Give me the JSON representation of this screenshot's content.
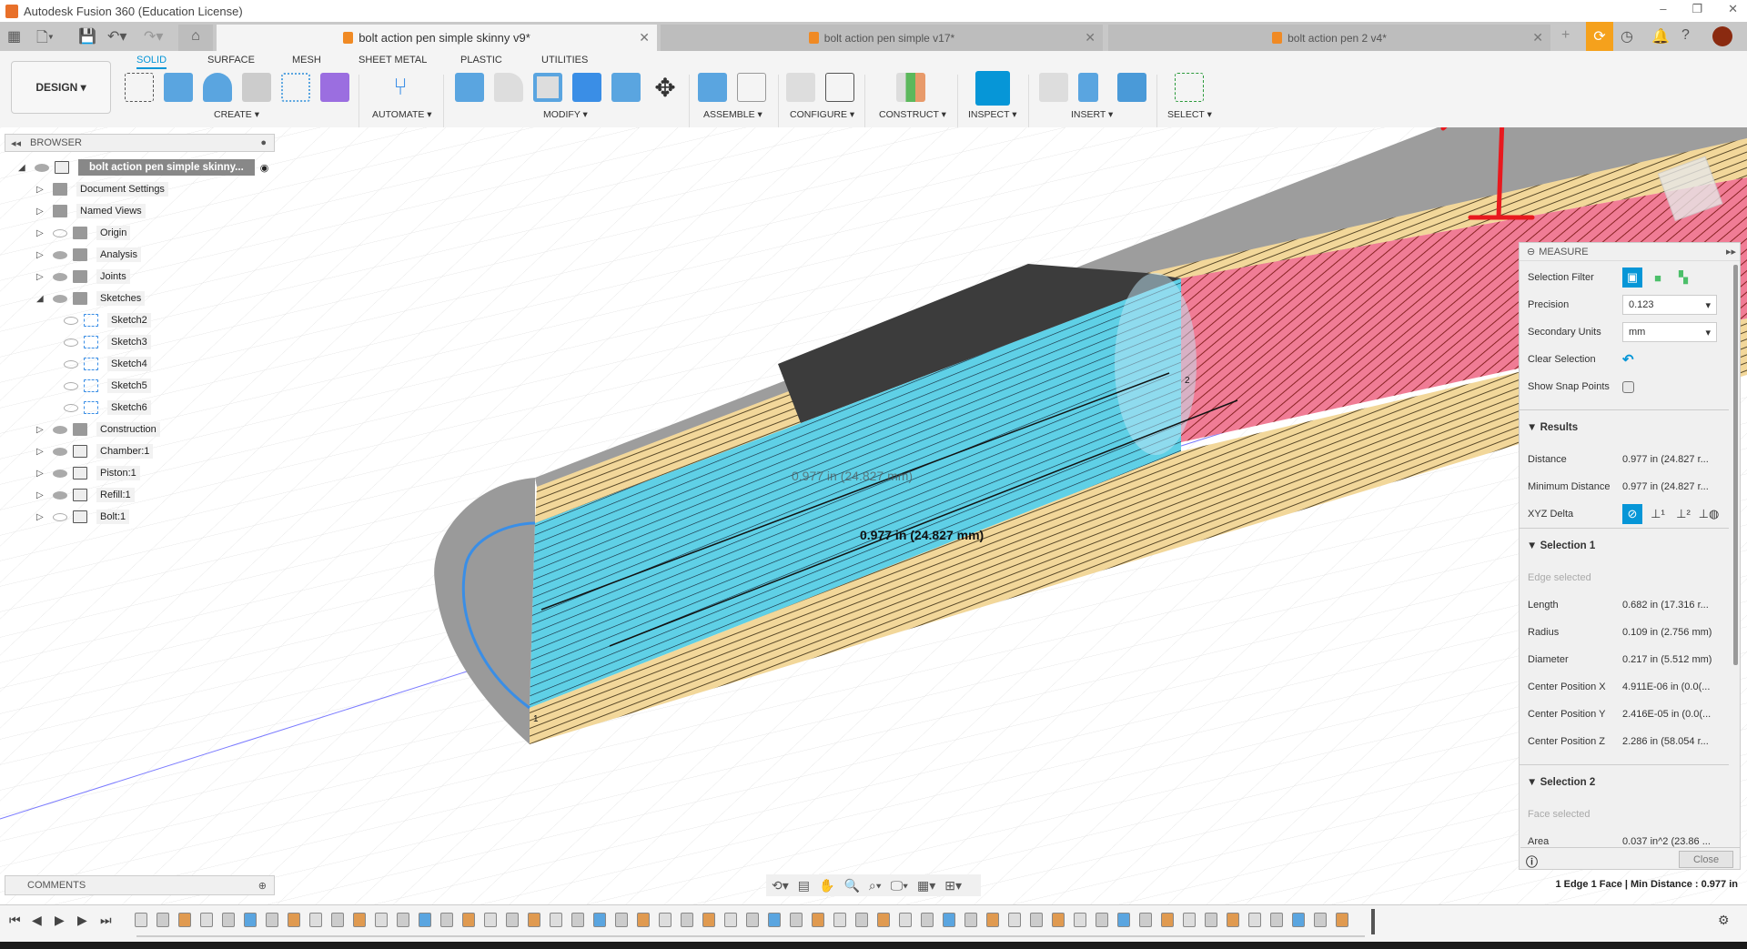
{
  "app": {
    "title": "Autodesk Fusion 360 (Education License)",
    "window_controls": [
      "–",
      "❐",
      "✕"
    ]
  },
  "tabs": [
    {
      "label": "bolt action pen simple skinny v9*",
      "active": true
    },
    {
      "label": "bolt action pen simple v17*",
      "active": false
    },
    {
      "label": "bolt action pen 2 v4*",
      "active": false
    }
  ],
  "toolbar": {
    "workspace": "DESIGN ▾",
    "tabs": [
      "SOLID",
      "SURFACE",
      "MESH",
      "SHEET METAL",
      "PLASTIC",
      "UTILITIES"
    ],
    "active_tab": "SOLID",
    "groups": [
      "CREATE ▾",
      "AUTOMATE ▾",
      "MODIFY ▾",
      "ASSEMBLE ▾",
      "CONFIGURE ▾",
      "CONSTRUCT ▾",
      "INSPECT ▾",
      "INSERT ▾",
      "SELECT ▾"
    ],
    "accent": "#0696d7"
  },
  "browser": {
    "title": "BROWSER",
    "root": "bolt action pen simple skinny...",
    "items": [
      {
        "label": "Document Settings",
        "icon": "gear-icon",
        "eye": "none",
        "indent": 1,
        "expanded": false
      },
      {
        "label": "Named Views",
        "icon": "folder-icon",
        "eye": "none",
        "indent": 1,
        "expanded": false
      },
      {
        "label": "Origin",
        "icon": "folder-icon",
        "eye": "hidden",
        "indent": 1,
        "expanded": false
      },
      {
        "label": "Analysis",
        "icon": "folder-icon",
        "eye": "visible",
        "indent": 1,
        "expanded": false
      },
      {
        "label": "Joints",
        "icon": "folder-icon",
        "eye": "visible",
        "indent": 1,
        "expanded": false
      },
      {
        "label": "Sketches",
        "icon": "folder-icon",
        "eye": "visible",
        "indent": 1,
        "expanded": true
      },
      {
        "label": "Sketch2",
        "icon": "sketch-icon",
        "eye": "hidden",
        "indent": 2
      },
      {
        "label": "Sketch3",
        "icon": "sketch-icon",
        "eye": "hidden",
        "indent": 2
      },
      {
        "label": "Sketch4",
        "icon": "sketch-icon",
        "eye": "hidden",
        "indent": 2
      },
      {
        "label": "Sketch5",
        "icon": "sketch-icon",
        "eye": "hidden",
        "indent": 2
      },
      {
        "label": "Sketch6",
        "icon": "sketch-icon",
        "eye": "hidden",
        "indent": 2
      },
      {
        "label": "Construction",
        "icon": "folder-icon",
        "eye": "visible",
        "indent": 1,
        "expanded": false
      },
      {
        "label": "Chamber:1",
        "icon": "component-icon",
        "eye": "visible",
        "indent": 1,
        "expanded": false
      },
      {
        "label": "Piston:1",
        "icon": "component-icon",
        "eye": "visible",
        "indent": 1,
        "expanded": false
      },
      {
        "label": "Refill:1",
        "icon": "component-icon",
        "eye": "visible",
        "indent": 1,
        "expanded": false
      },
      {
        "label": "Bolt:1",
        "icon": "component-icon",
        "eye": "hidden",
        "indent": 1,
        "expanded": false
      }
    ]
  },
  "viewport": {
    "dimension_label": "0.977 in (24.827 mm)",
    "point_labels": [
      "1",
      "2"
    ],
    "annotation": "1"
  },
  "measure": {
    "title": "MEASURE",
    "selection_filter_label": "Selection Filter",
    "precision_label": "Precision",
    "precision_value": "0.123",
    "secondary_units_label": "Secondary Units",
    "secondary_units_value": "mm",
    "clear_selection_label": "Clear Selection",
    "show_snap_points_label": "Show Snap Points",
    "show_snap_points": false,
    "results_title": "Results",
    "results": [
      {
        "k": "Distance",
        "v": "0.977 in (24.827 r..."
      },
      {
        "k": "Minimum Distance",
        "v": "0.977 in (24.827 r..."
      }
    ],
    "xyz_delta_label": "XYZ Delta",
    "selection1_title": "Selection 1",
    "selection1_type": "Edge selected",
    "selection1": [
      {
        "k": "Length",
        "v": "0.682 in (17.316 r..."
      },
      {
        "k": "Radius",
        "v": "0.109 in (2.756 mm)"
      },
      {
        "k": "Diameter",
        "v": "0.217 in (5.512 mm)"
      },
      {
        "k": "Center Position X",
        "v": "4.911E-06 in (0.0(..."
      },
      {
        "k": "Center Position Y",
        "v": "2.416E-05 in (0.0(..."
      },
      {
        "k": "Center Position Z",
        "v": "2.286 in (58.054 r..."
      }
    ],
    "selection2_title": "Selection 2",
    "selection2_type": "Face selected",
    "selection2": [
      {
        "k": "Area",
        "v": "0.037 in^2 (23.86 ..."
      }
    ],
    "close_label": "Close"
  },
  "comments": {
    "title": "COMMENTS"
  },
  "status": "1 Edge 1 Face | Min Distance : 0.977 in"
}
